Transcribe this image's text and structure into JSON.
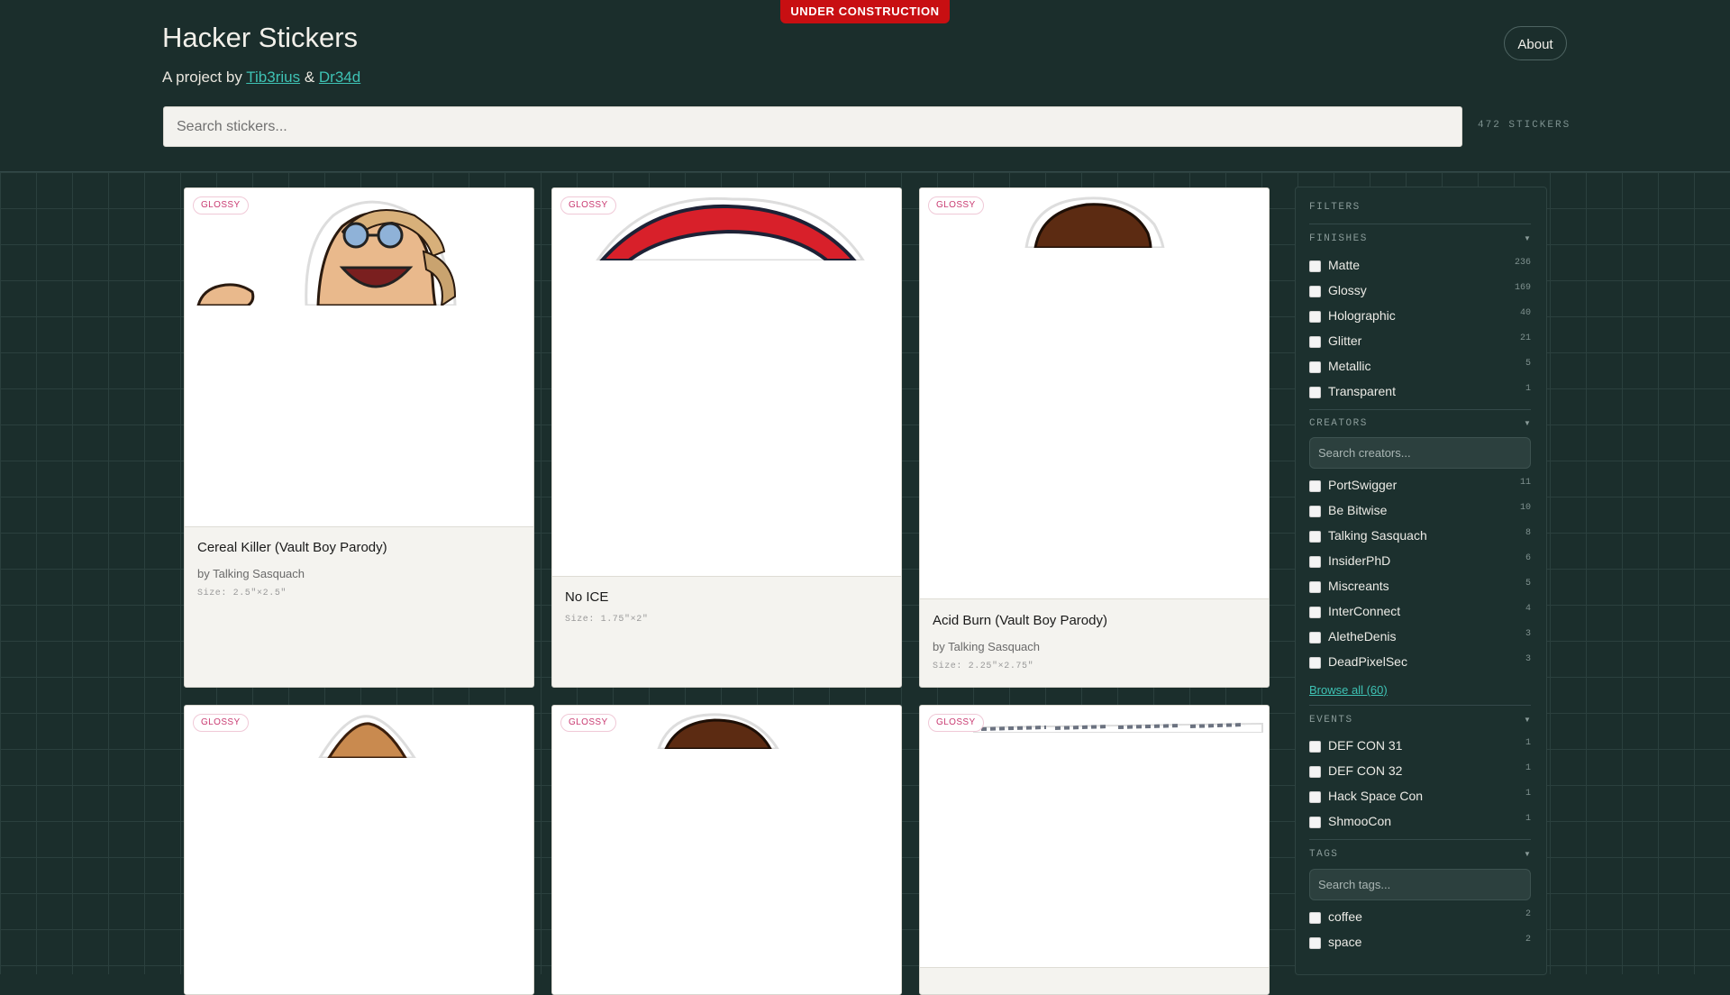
{
  "banner": "UNDER CONSTRUCTION",
  "site": {
    "title": "Hacker Stickers",
    "subtitle_prefix": "A project by",
    "author1": "Tib3rius",
    "separator": "&",
    "author2": "Dr34d",
    "about_label": "About"
  },
  "search": {
    "placeholder": "Search stickers...",
    "count": "472 STICKERS"
  },
  "cards": [
    {
      "badge": "GLOSSY",
      "title": "Cereal Killer (Vault Boy Parody)",
      "creator": "by Talking Sasquach",
      "size": "Size: 2.5\"×2.5\""
    },
    {
      "badge": "GLOSSY",
      "title": "No ICE",
      "size": "Size: 1.75\"×2\""
    },
    {
      "badge": "GLOSSY",
      "title": "Acid Burn (Vault Boy Parody)",
      "creator": "by Talking Sasquach",
      "size": "Size: 2.25\"×2.75\""
    },
    {
      "badge": "GLOSSY"
    },
    {
      "badge": "GLOSSY"
    },
    {
      "badge": "GLOSSY"
    }
  ],
  "sidebar": {
    "heading": "FILTERS",
    "finishes": {
      "label": "FINISHES",
      "items": [
        {
          "label": "Matte",
          "count": "236"
        },
        {
          "label": "Glossy",
          "count": "169"
        },
        {
          "label": "Holographic",
          "count": "40"
        },
        {
          "label": "Glitter",
          "count": "21"
        },
        {
          "label": "Metallic",
          "count": "5"
        },
        {
          "label": "Transparent",
          "count": "1"
        }
      ]
    },
    "creators": {
      "label": "CREATORS",
      "placeholder": "Search creators...",
      "items": [
        {
          "label": "PortSwigger",
          "count": "11"
        },
        {
          "label": "Be Bitwise",
          "count": "10"
        },
        {
          "label": "Talking Sasquach",
          "count": "8"
        },
        {
          "label": "InsiderPhD",
          "count": "6"
        },
        {
          "label": "Miscreants",
          "count": "5"
        },
        {
          "label": "InterConnect",
          "count": "4"
        },
        {
          "label": "AletheDenis",
          "count": "3"
        },
        {
          "label": "DeadPixelSec",
          "count": "3"
        }
      ],
      "browse": "Browse all (60)"
    },
    "events": {
      "label": "EVENTS",
      "items": [
        {
          "label": "DEF CON 31",
          "count": "1"
        },
        {
          "label": "DEF CON 32",
          "count": "1"
        },
        {
          "label": "Hack Space Con",
          "count": "1"
        },
        {
          "label": "ShmooCon",
          "count": "1"
        }
      ]
    },
    "tags": {
      "label": "TAGS",
      "placeholder": "Search tags...",
      "items": [
        {
          "label": "coffee",
          "count": "2"
        },
        {
          "label": "space",
          "count": "2"
        }
      ]
    }
  },
  "colors": {
    "background": "#1b2e2c",
    "accent": "#3ec2b4",
    "banner": "#c80f12",
    "badge_text": "#c93a71"
  }
}
